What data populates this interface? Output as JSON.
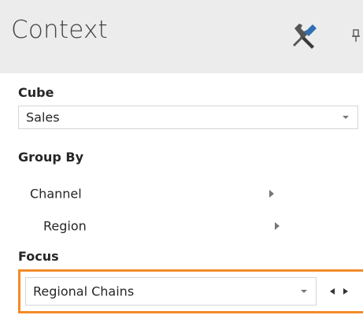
{
  "header": {
    "title": "Context",
    "icons": [
      "tools-icon",
      "pin-icon"
    ]
  },
  "cube": {
    "label": "Cube",
    "selected": "Sales"
  },
  "group_by": {
    "label": "Group By",
    "items": [
      {
        "label": "Channel"
      },
      {
        "label": "Region"
      }
    ]
  },
  "focus": {
    "label": "Focus",
    "selected": "Regional Chains",
    "highlight_color": "#f28c28"
  }
}
